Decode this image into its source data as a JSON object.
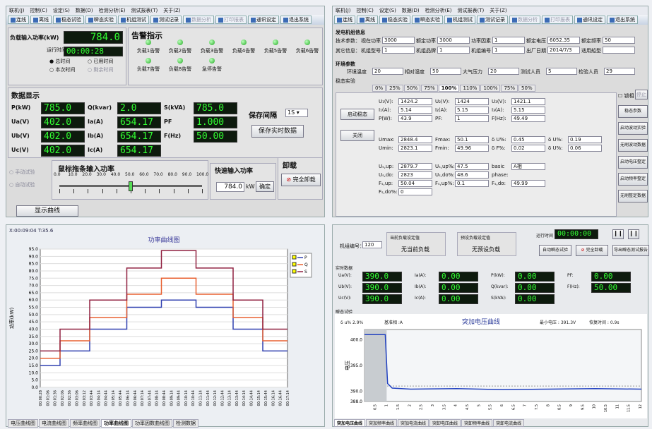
{
  "menu": [
    "联机(J)",
    "控制(C)",
    "设定(S)",
    "数据(D)",
    "检测分析(E)",
    "测试报表(T)",
    "关于(Z)"
  ],
  "tl": {
    "toolbar": [
      "连线",
      "离线",
      "稳态试验",
      "瞬态实验",
      "机组测试",
      "测试记录",
      "数据分析",
      "打印报表",
      "通讯设定",
      "退出系统"
    ],
    "load_input_label": "负载输入功率(kW)",
    "load_input_value": "784.0",
    "run_time_label": "运行时间",
    "run_time_value": "00:00:28",
    "opt_total": "总时间",
    "opt_elapsed": "已用时间",
    "opt_this": "本次时间",
    "opt_remain": "剩余时间",
    "alarm_title": "告警指示",
    "alarms": [
      "负载1告警",
      "负载2告警",
      "负载3告警",
      "负载4告警",
      "负载5告警",
      "负载6告警",
      "负载7告警",
      "负载8告警",
      "急停告警"
    ],
    "data_title": "数据显示",
    "p_label": "P(kW)",
    "p": "785.0",
    "q_label": "Q(kvar)",
    "q": "2.0",
    "s_label": "S(kVA)",
    "s": "785.0",
    "ua_label": "Ua(V)",
    "ua": "402.0",
    "ia_label": "Ia(A)",
    "ia": "654.17",
    "pf_label": "PF",
    "pf": "1.000",
    "ub_label": "Ub(V)",
    "ub": "402.0",
    "ib_label": "Ib(A)",
    "ib": "654.17",
    "f_label": "F(Hz)",
    "f": "50.00",
    "uc_label": "Uc(V)",
    "uc": "402.0",
    "ic_label": "Ic(A)",
    "ic": "654.17",
    "save_interval_label": "保存间隔",
    "save_interval": "1S",
    "save_btn": "保存实时数据",
    "mode_manual": "手动试验",
    "mode_auto": "自动试验",
    "slider_title": "鼠标拖条输入功率",
    "slider_ticks": [
      "0.0",
      "10.0",
      "20.0",
      "30.0",
      "40.0",
      "50.0",
      "60.0",
      "70.0",
      "80.0",
      "90.0",
      "100.0"
    ],
    "slider_level": 0.5,
    "quick_title": "快速输入功率",
    "quick_value": "784.0",
    "quick_unit": "kW",
    "confirm": "确定",
    "unload_title": "卸载",
    "unload_btn": "完全卸载",
    "show_curve": "显示曲线"
  },
  "tr": {
    "toolbar": [
      "连线",
      "离线",
      "稳态实验",
      "瞬态实验",
      "机组测试",
      "测试记录",
      "数据分析",
      "打印报表",
      "通讯设定",
      "退出系统"
    ],
    "gen_info": "发电机组信息",
    "rows": [
      {
        "h": "技术参数：",
        "cells": [
          [
            "视在功率",
            "3000"
          ],
          [
            "额定功率",
            "3000"
          ],
          [
            "功率因素",
            "1"
          ],
          [
            "额定电压",
            "6052.35"
          ],
          [
            "额定频率",
            "50"
          ]
        ]
      },
      {
        "h": "其它信息：",
        "cells": [
          [
            "机组型号",
            "1"
          ],
          [
            "机组品牌",
            "1"
          ],
          [
            "机组编号",
            "1"
          ],
          [
            "出厂日期",
            "2014/7/3"
          ],
          [
            "适用船型",
            ""
          ]
        ]
      }
    ],
    "env_title": "环境参数",
    "env": [
      [
        "环境温度",
        "20"
      ],
      [
        "相对湿度",
        "50"
      ],
      [
        "大气压力",
        "20"
      ],
      [
        "测试人员",
        "5"
      ],
      [
        "检验人员",
        "29"
      ]
    ],
    "steady_title": "稳态实验",
    "tabs": [
      "0%",
      "25%",
      "50%",
      "75%",
      "100%",
      "110%",
      "100%",
      "75%",
      "50%"
    ],
    "tab_on": 4,
    "btn_steady": "启动稳态",
    "btn_close": "关闭",
    "g1": [
      [
        "U₁(V):",
        "1424.2"
      ],
      [
        "U₂(V):",
        "1424"
      ],
      [
        "U₃(V):",
        "1421.1"
      ],
      [
        "I₁(A):",
        "5.14"
      ],
      [
        "I₂(A):",
        "5.15"
      ],
      [
        "I₃(A):",
        "5.15"
      ],
      [
        "P(W):",
        "43.9"
      ],
      [
        "PF:",
        "1"
      ],
      [
        "F(Hz):",
        "49.49"
      ]
    ],
    "g2": [
      [
        "Umax:",
        "2848.4"
      ],
      [
        "Fmax:",
        "50.1"
      ],
      [
        "δ U%:",
        "0.45"
      ],
      [
        "δ U%:",
        "0.19"
      ],
      [
        "Umin:",
        "2823.1"
      ],
      [
        "Fmin:",
        "49.96"
      ],
      [
        "δ F%:",
        "0.02"
      ],
      [
        "δ U%:",
        "0.06"
      ]
    ],
    "g3": [
      [
        "Uₛ,up:",
        "2879.7"
      ],
      [
        "Uₛ,up%:",
        "47.5"
      ],
      [
        "basic",
        "A相"
      ],
      [
        "Uₛ,do:",
        "2823"
      ],
      [
        "Uₛ,do%:",
        "48.6"
      ],
      [
        "phase:",
        ""
      ],
      [
        "Fₛ,up:",
        "50.04"
      ],
      [
        "Fₛ,up%:",
        "0.1"
      ],
      [
        "Fₛ,do:",
        "49.99"
      ],
      [
        "Fₛ,do%:",
        "0"
      ]
    ],
    "side_btns": [
      "稳态参数",
      "启动波动实验",
      "无刷波动数据",
      "启动电压整定",
      "启动频率整定",
      "无刷整定数据"
    ],
    "chk": "锁相",
    "stop": "停止"
  },
  "bl": {
    "status": "X:00:09:04  T:35.6",
    "legend": [
      "P",
      "Q",
      "S"
    ],
    "tabs": [
      "电压曲线图",
      "电流曲线图",
      "频率曲线图",
      "功率曲线图",
      "功率因数曲线图",
      "检测数据"
    ],
    "tab_on": 3
  },
  "br": {
    "unit_label": "机组编号：",
    "unit_value": "120",
    "cur_load_title": "当前负载设定值",
    "cur_load_value": "无当前负载",
    "pre_load_title": "预设负载设定值",
    "pre_load_value": "无预设负载",
    "run_label": "运行时间",
    "run_value": "00:00:00",
    "btns": [
      "自动瞬态试验",
      "完全卸载",
      "导出瞬态测试报告"
    ],
    "rt_title": "实时数据",
    "rt": [
      [
        "Ua(V):",
        "390.0"
      ],
      [
        "Ia(A):",
        "0.00"
      ],
      [
        "P(kW):",
        "0.00"
      ],
      [
        "PF:",
        "0.00"
      ],
      [
        "Ub(V):",
        "390.0"
      ],
      [
        "Ib(A):",
        "0.00"
      ],
      [
        "Q(kvar):",
        "0.00"
      ],
      [
        "F(Hz):",
        "50.00"
      ],
      [
        "Uc(V):",
        "390.0"
      ],
      [
        "Ic(A):",
        "0.00"
      ],
      [
        "S(kVA):",
        "0.00"
      ]
    ],
    "transient_title": "瞬态试验",
    "chart_header": [
      "δ u% 2.9%",
      "基准相 :A",
      "突加电压曲线",
      "最小电压 : 391.3V",
      "恢复时间 : 0.9s"
    ],
    "tabs": [
      "突加电压曲线",
      "突加频率曲线",
      "突加电流曲线",
      "突卸电压曲线",
      "突卸频率曲线",
      "突卸电流曲线"
    ],
    "tab_on": 0
  },
  "chart_data": [
    {
      "type": "line",
      "title": "功率曲线图",
      "ylabel": "功率(kW)",
      "ylim": [
        0,
        95
      ],
      "yticks": [
        "0.0",
        "5.0",
        "10.0",
        "15.0",
        "20.0",
        "25.0",
        "30.0",
        "35.0",
        "40.0",
        "45.0",
        "50.0",
        "55.0",
        "60.0",
        "65.0",
        "70.0",
        "75.0",
        "80.0",
        "85.0",
        "90.0",
        "95.0"
      ],
      "xticks": [
        "00:00:28",
        "00:01:06",
        "00:01:36",
        "00:02:06",
        "00:02:36",
        "00:03:06",
        "00:03:12",
        "00:03:44",
        "00:04:14",
        "00:04:44",
        "00:05:14",
        "00:05:44",
        "00:06:14",
        "00:06:44",
        "00:07:14",
        "00:07:44",
        "00:08:14",
        "00:08:44",
        "00:09:14",
        "00:09:44",
        "00:10:14",
        "00:10:44",
        "00:11:14",
        "00:11:44",
        "00:12:14",
        "00:12:44",
        "00:13:14",
        "00:13:44",
        "00:14:14",
        "00:14:44",
        "00:15:14",
        "00:15:44",
        "00:16:14",
        "00:16:44",
        "00:17:14"
      ],
      "series": [
        {
          "name": "P",
          "color": "#3040b0",
          "steps": [
            [
              0,
              15
            ],
            [
              0.08,
              25
            ],
            [
              0.2,
              40
            ],
            [
              0.35,
              55
            ],
            [
              0.49,
              60
            ],
            [
              0.63,
              55
            ],
            [
              0.78,
              40
            ],
            [
              0.9,
              25
            ],
            [
              1,
              25
            ]
          ]
        },
        {
          "name": "Q",
          "color": "#e86030",
          "steps": [
            [
              0,
              20
            ],
            [
              0.08,
              32
            ],
            [
              0.2,
              48
            ],
            [
              0.35,
              64
            ],
            [
              0.49,
              75
            ],
            [
              0.63,
              64
            ],
            [
              0.78,
              48
            ],
            [
              0.9,
              32
            ],
            [
              1,
              32
            ]
          ]
        },
        {
          "name": "S",
          "color": "#902040",
          "steps": [
            [
              0,
              25
            ],
            [
              0.08,
              40
            ],
            [
              0.2,
              60
            ],
            [
              0.35,
              82
            ],
            [
              0.49,
              94
            ],
            [
              0.63,
              82
            ],
            [
              0.78,
              60
            ],
            [
              0.9,
              40
            ],
            [
              1,
              40
            ]
          ]
        }
      ]
    },
    {
      "type": "line",
      "title": "突加电压曲线",
      "ylabel": "电压",
      "ylim": [
        388,
        402
      ],
      "yticks": [
        "388.0",
        "390.0",
        "395.0",
        "400.0"
      ],
      "xticks": [
        "0.5",
        "1",
        "1.5",
        "2",
        "2.5",
        "3",
        "3.5",
        "4",
        "4.5",
        "5",
        "5.5",
        "6",
        "6.5",
        "7",
        "7.5",
        "8",
        "8.5",
        "9",
        "9.5",
        "10",
        "10.5",
        "11",
        "11.5",
        "12"
      ],
      "series": [
        {
          "name": "",
          "color": "#2040c0",
          "points": [
            [
              0,
              401
            ],
            [
              0.6,
              401
            ],
            [
              0.9,
              401
            ],
            [
              1,
              391.5
            ],
            [
              1.2,
              390.6
            ],
            [
              2,
              390.4
            ],
            [
              4,
              390.5
            ],
            [
              6,
              390.3
            ],
            [
              8,
              390.4
            ],
            [
              10,
              390.5
            ],
            [
              12,
              390.4
            ]
          ]
        }
      ]
    }
  ]
}
